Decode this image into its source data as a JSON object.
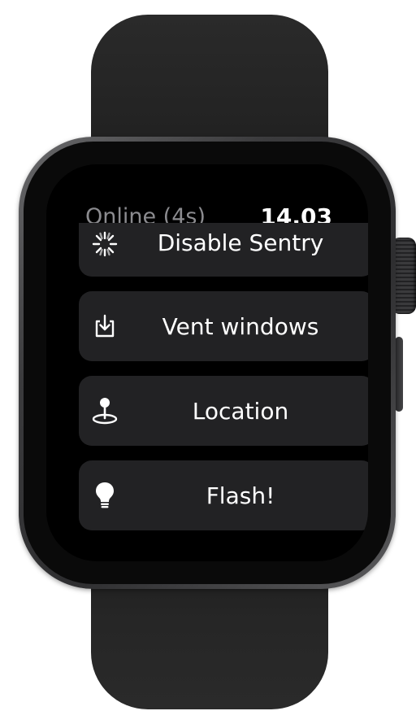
{
  "status": {
    "connection": "Online (4s)",
    "time": "14.03"
  },
  "actions": [
    {
      "label": "Disable Sentry",
      "icon": "sentry-burst-icon"
    },
    {
      "label": "Vent windows",
      "icon": "download-tray-icon"
    },
    {
      "label": "Location",
      "icon": "map-pin-icon"
    },
    {
      "label": "Flash!",
      "icon": "lightbulb-icon"
    }
  ],
  "colors": {
    "background": "#000000",
    "row": "#222224",
    "status_secondary": "#8b8b8f",
    "text": "#ffffff"
  }
}
